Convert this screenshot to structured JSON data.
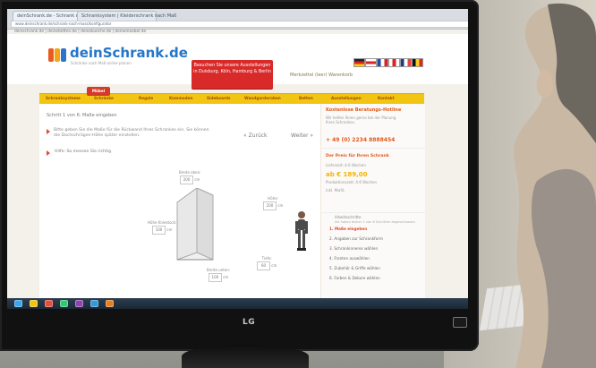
{
  "photo": {
    "monitor_brand": "LG"
  },
  "browser": {
    "tabs": [
      "deinSchrank.de - Schrank nach Maß",
      "Schranksystem | Kleiderschrank nach Maß"
    ],
    "url": "www.deinschrank.de/schrank-nach-mass/konfigurator",
    "toplinks": "deinschrank.de | deinebetten.de | deinekueche.de | deinemoebel.de"
  },
  "site": {
    "logo_name": "deinSchrank.de",
    "logo_tagline": "Schränke nach Maß online planen",
    "promo": "Besuchen Sie unsere Ausstellungen in Duisburg, Köln, Hamburg & Berlin",
    "utility": "Merkzettel (leer)  Warenkorb",
    "nav_active": "Möbel",
    "nav_items": [
      "Schranksysteme",
      "Schränke",
      "Regale",
      "Kommoden",
      "Sideboards",
      "Wandgarderoben",
      "Betten",
      "Ausstellungen",
      "Kontakt"
    ]
  },
  "configurator": {
    "step": "Schritt 1 von 6: Maße eingeben",
    "hint": "Bitte geben Sie die Maße für die Rückwand Ihres Schrankes ein. Sie können die Dachschrägen-Höhe später einstellen.",
    "help": "Hilfe: So messen Sie richtig",
    "prev": "«  Zurück",
    "next": "Weiter  »",
    "labels": [
      {
        "label": "Breite oben:",
        "value": "200",
        "unit": "cm"
      },
      {
        "label": "Höhe:",
        "value": "200",
        "unit": "cm"
      },
      {
        "label": "Höhe Kniestock:",
        "value": "100",
        "unit": "cm"
      },
      {
        "label": "Tiefe:",
        "value": "60",
        "unit": "cm"
      },
      {
        "label": "Breite unten:",
        "value": "100",
        "unit": "cm"
      }
    ]
  },
  "sidebar": {
    "help_title": "Kostenlose Beratungs-Hotline",
    "help_text": "Wir helfen Ihnen gerne bei der Planung Ihres Schrankes.",
    "phone": "+ 49 (0) 2234 8888454",
    "price_title": "Der Preis für Ihren Schrank",
    "price_row": "Lieferzeit: 4-6 Wochen",
    "price": "ab € 189,00",
    "price_sub": "Produktionszeit: 4-6 Wochen",
    "price_sub2": "inkl. MwSt.",
    "steps_title": "Arbeitsschritte",
    "steps_sub": "Sie haben bisher 1 von 6 Schritten abgeschlossen",
    "steps": [
      "1. Maße eingeben",
      "2. Angaben zur Schrankform",
      "3. Schrankinneres wählen",
      "4. Fronten auswählen",
      "5. Zubehör & Griffe wählen",
      "6. Farben & Dekore wählen"
    ]
  }
}
